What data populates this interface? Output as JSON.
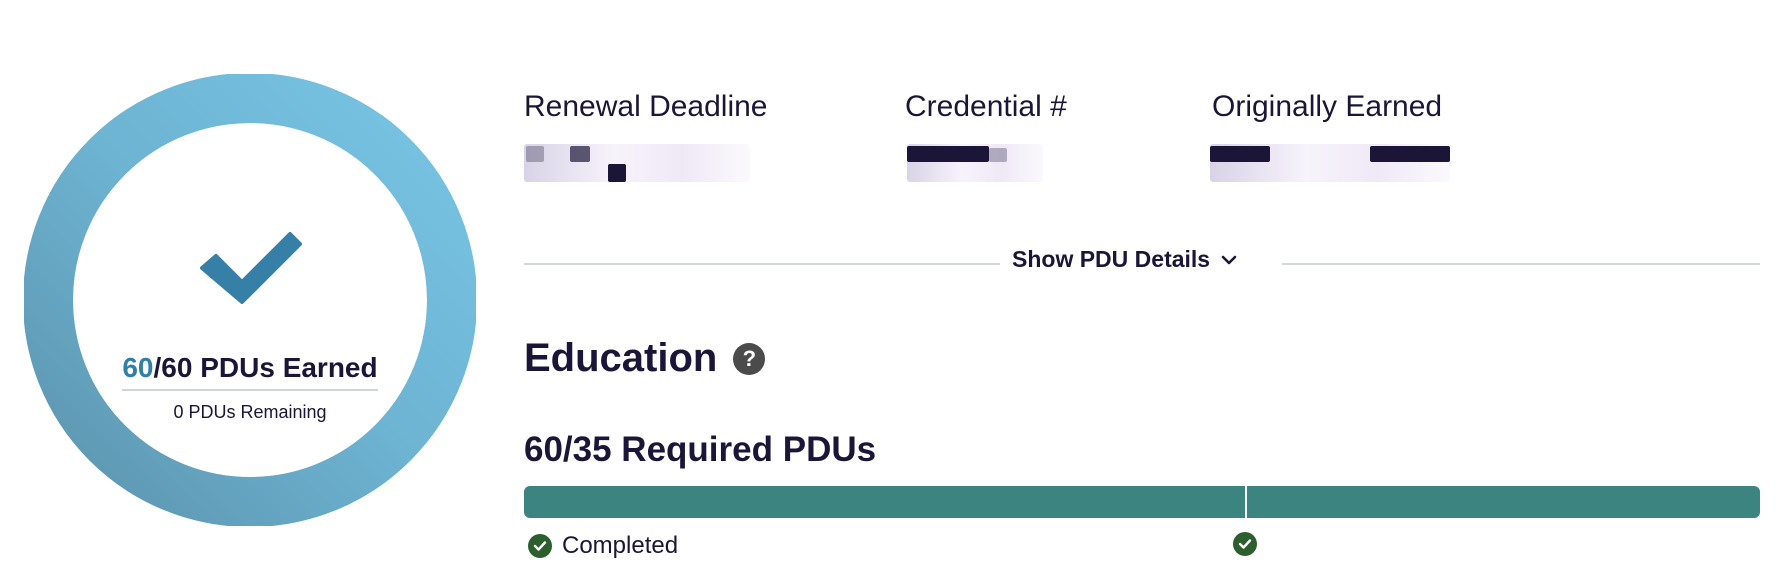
{
  "summary": {
    "earned": "60",
    "earned_suffix": "/60 PDUs Earned",
    "remaining": "0 PDUs Remaining",
    "progress_fraction": 1.0
  },
  "info": [
    {
      "label": "Renewal Deadline"
    },
    {
      "label": "Credential #"
    },
    {
      "label": "Originally Earned"
    }
  ],
  "toggle": {
    "label": "Show PDU Details"
  },
  "education": {
    "title": "Education",
    "required_heading": "60/35 Required PDUs",
    "required_fraction": 1.0,
    "marker_fraction": 0.5833,
    "status_label": "Completed"
  },
  "colors": {
    "ring_light": "#77c3e3",
    "ring_dark": "#5c94ad",
    "accent_blue": "#2f7fa7",
    "bar_green": "#3b8480",
    "check_green": "#2d5e2d",
    "text_dark": "#1b1537"
  }
}
